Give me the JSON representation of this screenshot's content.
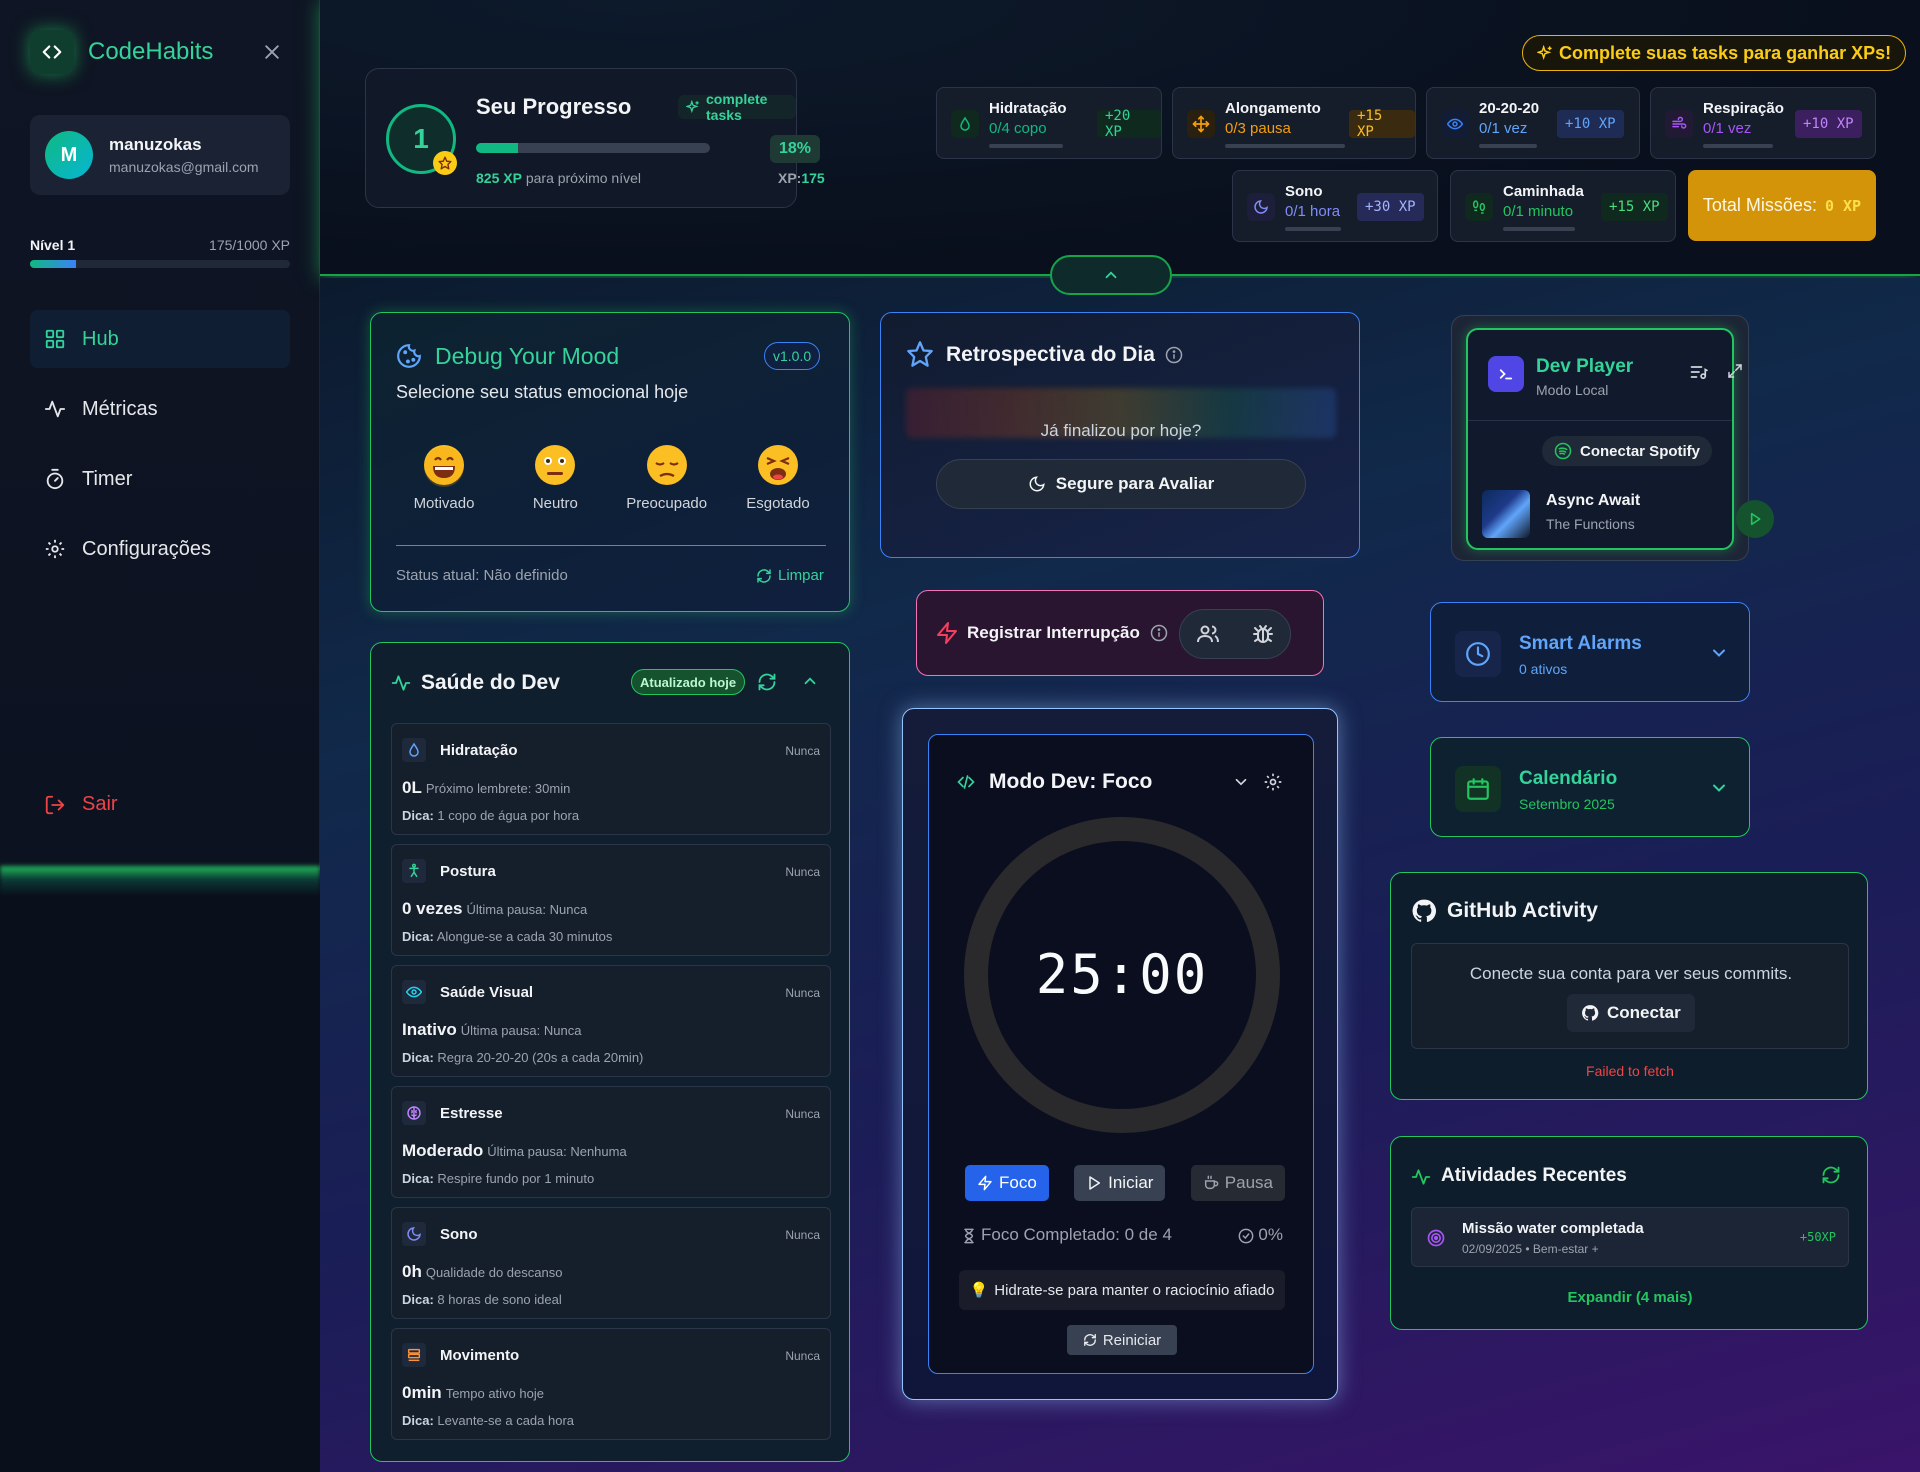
{
  "app": {
    "name": "CodeHabits"
  },
  "user": {
    "initial": "M",
    "name": "manuzokas",
    "email": "manuzokas@gmail.com",
    "level_label": "Nível 1",
    "level_xp": "175/1000 XP",
    "level_progress_pct": 17.5
  },
  "nav": {
    "items": [
      {
        "label": "Hub",
        "icon": "grid-icon",
        "active": true
      },
      {
        "label": "Métricas",
        "icon": "activity-icon",
        "active": false
      },
      {
        "label": "Timer",
        "icon": "timer-icon",
        "active": false
      },
      {
        "label": "Configurações",
        "icon": "gear-icon",
        "active": false
      }
    ],
    "logout": "Sair"
  },
  "progress": {
    "level": "1",
    "title": "Seu Progresso",
    "badge": "complete tasks",
    "percent": "18%",
    "percent_value": 18,
    "xp_next": "825 XP",
    "xp_next_suffix": "para próximo nível",
    "xp_label": "XP:",
    "xp_value": "175"
  },
  "cta": "Complete suas tasks para ganhar XPs!",
  "missions": [
    {
      "title": "Hidratação",
      "sub": "0/4 copo",
      "xp": "+20 XP",
      "icon": "droplet-icon",
      "color": "#10b981"
    },
    {
      "title": "Alongamento",
      "sub": "0/3 pausa",
      "xp": "+15 XP",
      "icon": "move-icon",
      "color": "#f59e0b"
    },
    {
      "title": "20-20-20",
      "sub": "0/1 vez",
      "xp": "+10 XP",
      "icon": "eye-icon",
      "color": "#3b82f6"
    },
    {
      "title": "Respiração",
      "sub": "0/1 vez",
      "xp": "+10 XP",
      "icon": "wind-icon",
      "color": "#a855f7"
    },
    {
      "title": "Sono",
      "sub": "0/1 hora",
      "xp": "+30 XP",
      "icon": "moon-icon",
      "color": "#818cf8"
    },
    {
      "title": "Caminhada",
      "sub": "0/1 minuto",
      "xp": "+15 XP",
      "icon": "footprints-icon",
      "color": "#22c55e"
    }
  ],
  "total_missions": {
    "label": "Total Missões:",
    "xp": "0 XP"
  },
  "mood": {
    "title": "Debug Your Mood",
    "version": "v1.0.0",
    "subtitle": "Selecione seu status emocional hoje",
    "options": [
      {
        "label": "Motivado",
        "emoji": "grin-emoji"
      },
      {
        "label": "Neutro",
        "emoji": "neutral-emoji"
      },
      {
        "label": "Preocupado",
        "emoji": "worried-emoji"
      },
      {
        "label": "Esgotado",
        "emoji": "tired-emoji"
      }
    ],
    "status": "Status atual: Não definido",
    "clear": "Limpar"
  },
  "health": {
    "title": "Saúde do Dev",
    "badge": "Atualizado hoje",
    "items": [
      {
        "name": "Hidratação",
        "never": "Nunca",
        "value": "0L",
        "note": "Próximo lembrete: 30min",
        "tip_label": "Dica:",
        "tip": "1 copo de água por hora",
        "icon": "droplet-icon",
        "color": "#60a5fa"
      },
      {
        "name": "Postura",
        "never": "Nunca",
        "value": "0 vezes",
        "note": "Última pausa: Nunca",
        "tip_label": "Dica:",
        "tip": "Alongue-se a cada 30 minutos",
        "icon": "accessibility-icon",
        "color": "#34d399"
      },
      {
        "name": "Saúde Visual",
        "never": "Nunca",
        "value": "Inativo",
        "note": "Última pausa: Nunca",
        "tip_label": "Dica:",
        "tip": "Regra 20-20-20 (20s a cada 20min)",
        "icon": "eye-icon",
        "color": "#22d3ee"
      },
      {
        "name": "Estresse",
        "never": "Nunca",
        "value": "Moderado",
        "note": "Última pausa: Nenhuma",
        "tip_label": "Dica:",
        "tip": "Respire fundo por 1 minuto",
        "icon": "brain-icon",
        "color": "#c084fc"
      },
      {
        "name": "Sono",
        "never": "Nunca",
        "value": "0h",
        "note": "Qualidade do descanso",
        "tip_label": "Dica:",
        "tip": "8 horas de sono ideal",
        "icon": "moon-icon",
        "color": "#818cf8"
      },
      {
        "name": "Movimento",
        "never": "Nunca",
        "value": "0min",
        "note": "Tempo ativo hoje",
        "tip_label": "Dica:",
        "tip": "Levante-se a cada hora",
        "icon": "layers-icon",
        "color": "#fb923c"
      }
    ]
  },
  "retro": {
    "title": "Retrospectiva do Dia",
    "question": "Já finalizou por hoje?",
    "button": "Segure para Avaliar"
  },
  "interrupt": {
    "label": "Registrar Interrupção"
  },
  "timer": {
    "title": "Modo Dev: Foco",
    "time": "25:00",
    "buttons": {
      "foco": "Foco",
      "iniciar": "Iniciar",
      "pausa": "Pausa"
    },
    "completed": "Foco Completado: 0 de 4",
    "percent": "0%",
    "tip": "Hidrate-se para manter o raciocínio afiado",
    "reset": "Reiniciar"
  },
  "player": {
    "title": "Dev Player",
    "subtitle": "Modo Local",
    "connect": "Conectar Spotify",
    "song": "Async Await",
    "artist": "The Functions"
  },
  "alarms": {
    "title": "Smart Alarms",
    "sub": "0 ativos"
  },
  "calendar": {
    "title": "Calendário",
    "sub": "Setembro 2025"
  },
  "github": {
    "title": "GitHub Activity",
    "text": "Conecte sua conta para ver seus commits.",
    "button": "Conectar",
    "error": "Failed to fetch"
  },
  "activity": {
    "title": "Atividades Recentes",
    "items": [
      {
        "title": "Missão water completada",
        "sub": "02/09/2025 • Bem-estar +",
        "xp": "+50XP"
      }
    ],
    "expand": "Expandir (4 mais)"
  },
  "colors": {
    "accent": "#34d399",
    "brand_green": "#22c55e",
    "danger": "#ef4444",
    "blue": "#3b82f6",
    "gold": "#d4940a"
  }
}
